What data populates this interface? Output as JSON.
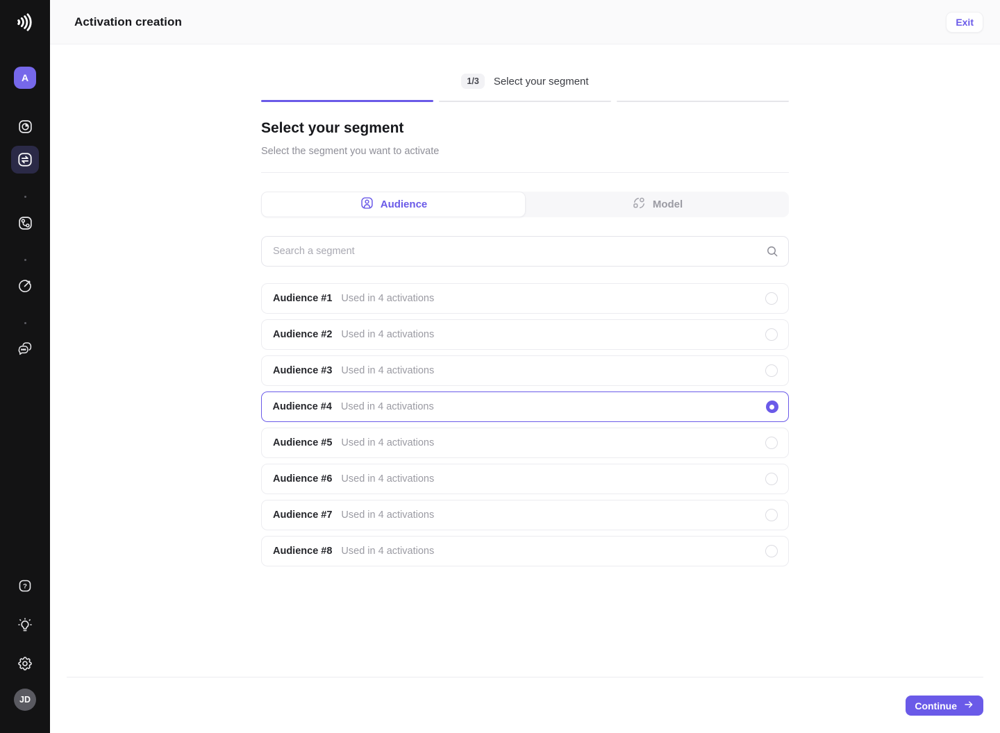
{
  "app": {
    "title": "Activation creation",
    "exit_label": "Exit"
  },
  "sidebar": {
    "workspace_avatar": "A",
    "user_avatar": "JD",
    "nav_icons": [
      "pie-chart-square",
      "activation-transfer",
      "flow-graph",
      "sync-arrow",
      "chat-bubbles"
    ],
    "bottom_icons": [
      "help",
      "lightbulb",
      "settings-gear"
    ]
  },
  "stepper": {
    "badge": "1/3",
    "label": "Select your segment",
    "current_step": 1,
    "total_steps": 3
  },
  "content": {
    "title": "Select your segment",
    "subtitle": "Select the segment you want to activate",
    "tabs": [
      {
        "label": "Audience",
        "active": true
      },
      {
        "label": "Model",
        "active": false
      }
    ],
    "search": {
      "placeholder": "Search a segment",
      "value": ""
    }
  },
  "segments": [
    {
      "name": "Audience #1",
      "meta": "Used in 4 activations",
      "selected": false
    },
    {
      "name": "Audience #2",
      "meta": "Used in 4 activations",
      "selected": false
    },
    {
      "name": "Audience #3",
      "meta": "Used in 4 activations",
      "selected": false
    },
    {
      "name": "Audience #4",
      "meta": "Used in 4 activations",
      "selected": true
    },
    {
      "name": "Audience #5",
      "meta": "Used in 4 activations",
      "selected": false
    },
    {
      "name": "Audience #6",
      "meta": "Used in 4 activations",
      "selected": false
    },
    {
      "name": "Audience #7",
      "meta": "Used in 4 activations",
      "selected": false
    },
    {
      "name": "Audience #8",
      "meta": "Used in 4 activations",
      "selected": false
    }
  ],
  "footer": {
    "continue_label": "Continue"
  },
  "colors": {
    "accent": "#6a5ae8",
    "sidebar_bg": "#131314",
    "active_nav_bg": "#2b2a47",
    "header_bg": "#fafafb"
  }
}
